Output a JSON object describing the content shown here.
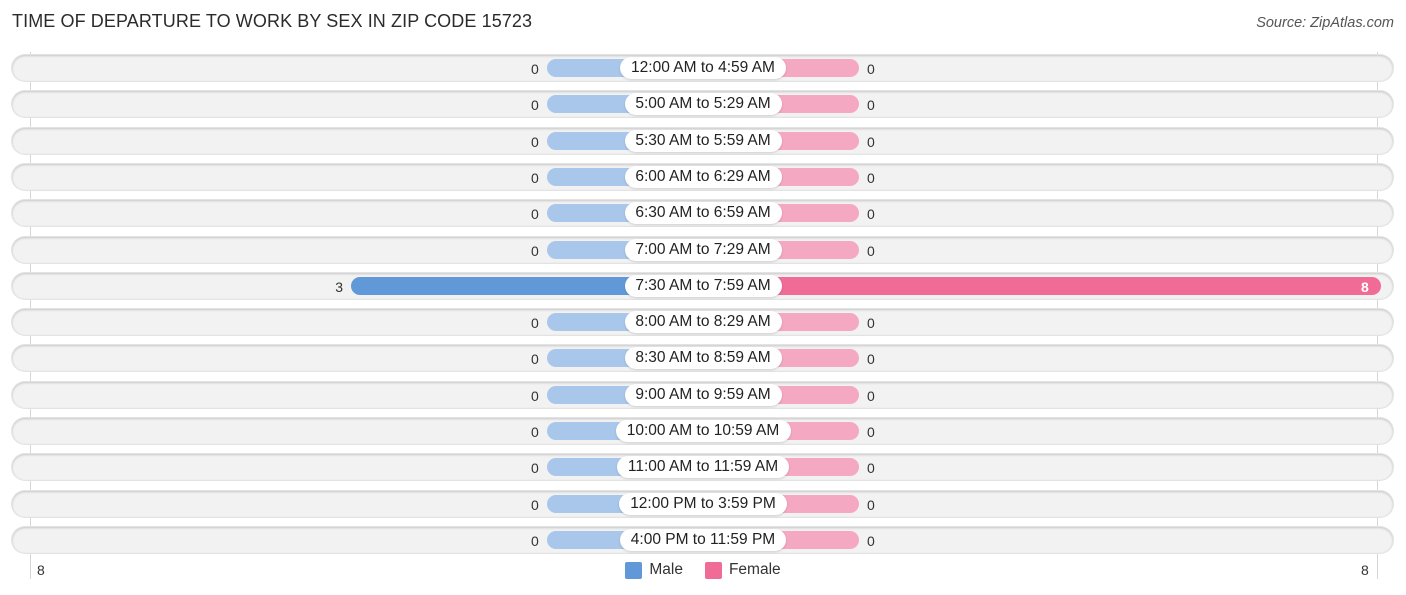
{
  "title": "TIME OF DEPARTURE TO WORK BY SEX IN ZIP CODE 15723",
  "source": "Source: ZipAtlas.com",
  "colors": {
    "male_strong": "#6199d8",
    "male_light": "#a9c7ea",
    "female_strong": "#f06b96",
    "female_light": "#f5a8c1"
  },
  "legend": [
    {
      "label": "Male",
      "color": "#6199d8"
    },
    {
      "label": "Female",
      "color": "#f06b96"
    }
  ],
  "chart_data": {
    "type": "bar",
    "orientation": "horizontal-diverging",
    "title": "TIME OF DEPARTURE TO WORK BY SEX IN ZIP CODE 15723",
    "categories": [
      "12:00 AM to 4:59 AM",
      "5:00 AM to 5:29 AM",
      "5:30 AM to 5:59 AM",
      "6:00 AM to 6:29 AM",
      "6:30 AM to 6:59 AM",
      "7:00 AM to 7:29 AM",
      "7:30 AM to 7:59 AM",
      "8:00 AM to 8:29 AM",
      "8:30 AM to 8:59 AM",
      "9:00 AM to 9:59 AM",
      "10:00 AM to 10:59 AM",
      "11:00 AM to 11:59 AM",
      "12:00 PM to 3:59 PM",
      "4:00 PM to 11:59 PM"
    ],
    "series": [
      {
        "name": "Male",
        "values": [
          0,
          0,
          0,
          0,
          0,
          0,
          3,
          0,
          0,
          0,
          0,
          0,
          0,
          0
        ]
      },
      {
        "name": "Female",
        "values": [
          0,
          0,
          0,
          0,
          0,
          0,
          8,
          0,
          0,
          0,
          0,
          0,
          0,
          0
        ]
      }
    ],
    "axis": {
      "left_tick": "8",
      "right_tick": "8",
      "max": 8
    },
    "xlabel": "",
    "ylabel": "",
    "legend_position": "bottom-center",
    "grid": false
  }
}
